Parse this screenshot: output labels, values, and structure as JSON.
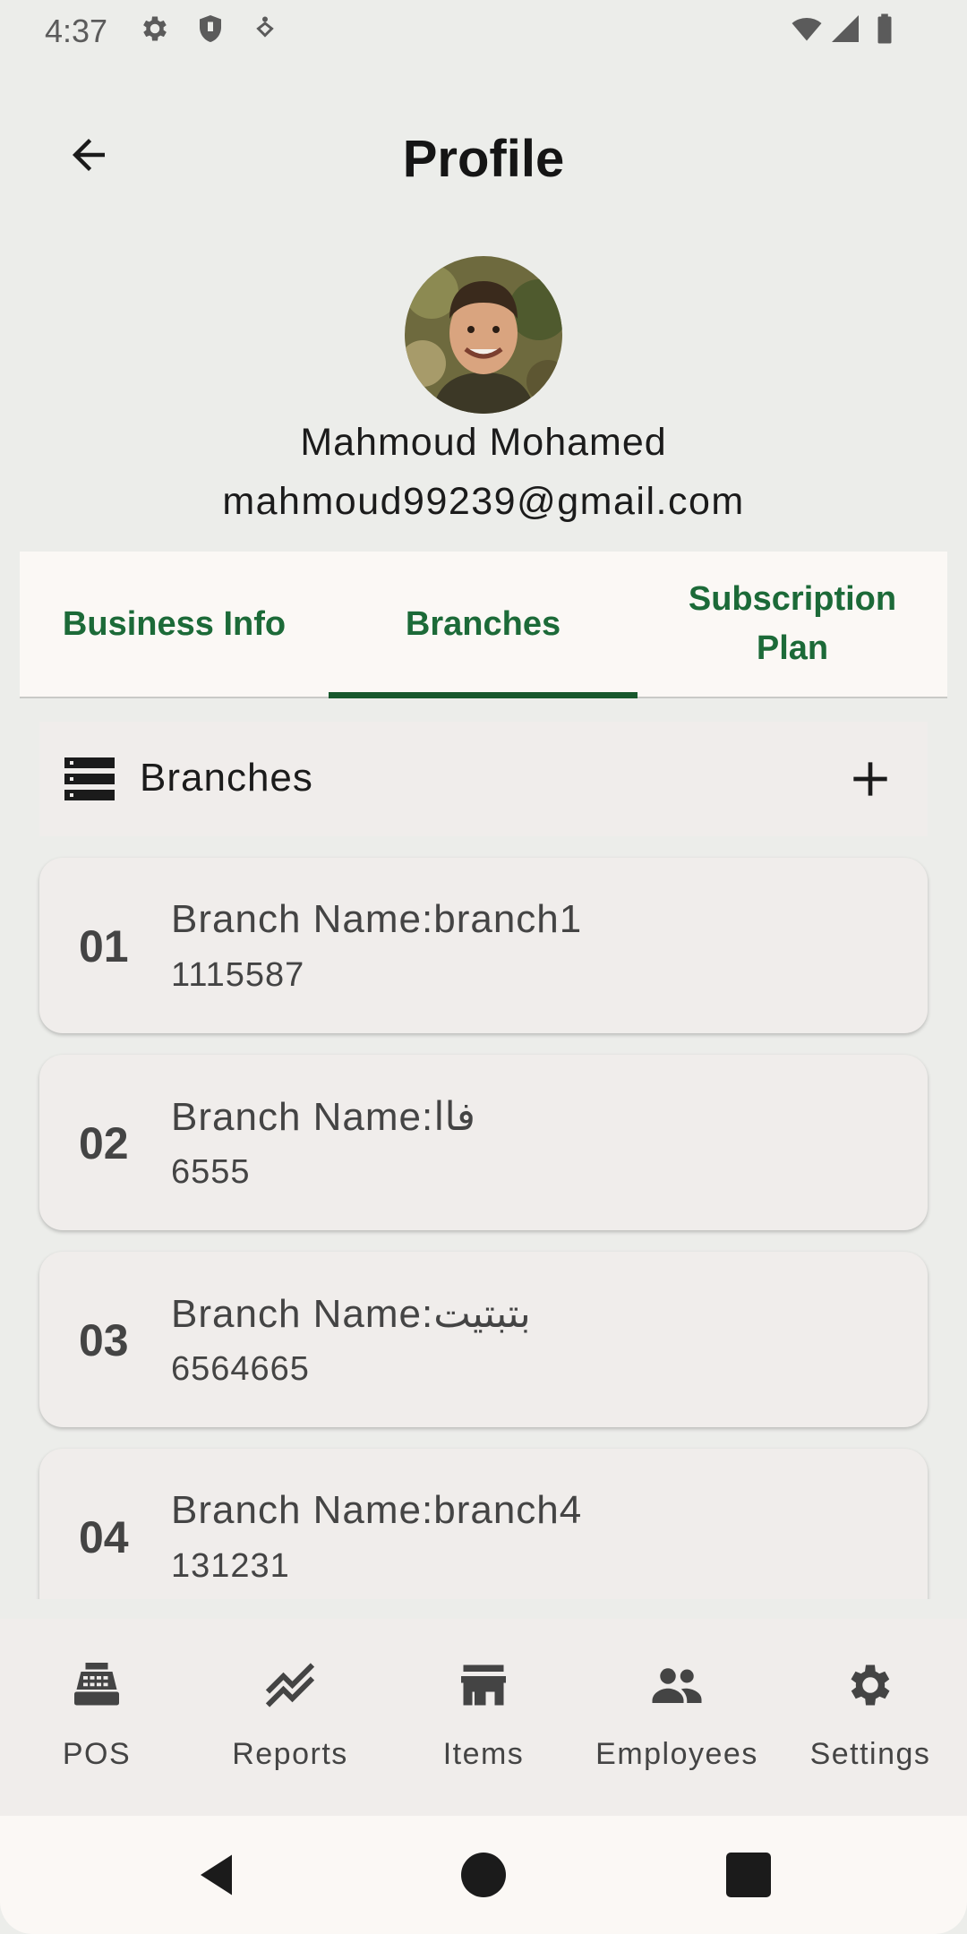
{
  "status_bar": {
    "time": "4:37",
    "left_icons": [
      "gear-icon",
      "shield-icon",
      "accessibility-icon"
    ],
    "right_icons": [
      "wifi-icon",
      "signal-icon",
      "battery-icon"
    ]
  },
  "header": {
    "title": "Profile",
    "back_icon": "arrow-back-icon"
  },
  "profile": {
    "name": "Mahmoud Mohamed",
    "email": "mahmoud99239@gmail.com"
  },
  "tabs": [
    {
      "label": "Business Info",
      "selected": false
    },
    {
      "label": "Branches",
      "selected": true
    },
    {
      "label": "Subscription Plan",
      "selected": false
    }
  ],
  "section": {
    "title": "Branches",
    "icon": "list-icon",
    "add_icon": "plus-icon"
  },
  "branches": [
    {
      "number": "01",
      "name": "Branch Name:branch1",
      "code": "1115587"
    },
    {
      "number": "02",
      "name": "Branch Name:فاا",
      "code": "6555"
    },
    {
      "number": "03",
      "name": "Branch Name:بتبتيت",
      "code": "6564665"
    },
    {
      "number": "04",
      "name": "Branch Name:branch4",
      "code": "131231"
    }
  ],
  "bottom_nav": [
    {
      "label": "POS",
      "icon": "cash-register-icon"
    },
    {
      "label": "Reports",
      "icon": "trend-icon"
    },
    {
      "label": "Items",
      "icon": "store-icon"
    },
    {
      "label": "Employees",
      "icon": "people-icon"
    },
    {
      "label": "Settings",
      "icon": "gear-icon"
    }
  ],
  "colors": {
    "accent": "#1c6a38",
    "indicator": "#17582c",
    "background": "#ecedea",
    "card": "#f0edeb"
  }
}
